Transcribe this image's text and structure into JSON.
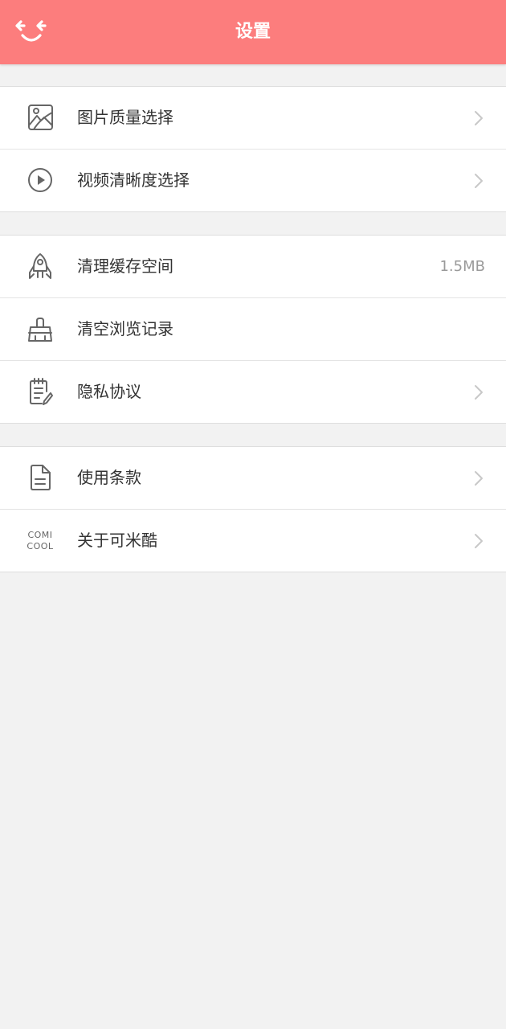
{
  "header": {
    "title": "设置",
    "back_icon": "smiley-back-arrows-icon",
    "background_color": "#fc7d7d"
  },
  "groups": [
    {
      "items": [
        {
          "label": "图片质量选择",
          "icon": "image-icon",
          "has_chevron": true
        },
        {
          "label": "视频清晰度选择",
          "icon": "play-circle-icon",
          "has_chevron": true
        }
      ]
    },
    {
      "items": [
        {
          "label": "清理缓存空间",
          "icon": "rocket-icon",
          "value": "1.5MB"
        },
        {
          "label": "清空浏览记录",
          "icon": "broom-icon"
        },
        {
          "label": "隐私协议",
          "icon": "notepad-icon",
          "has_chevron": true
        }
      ]
    },
    {
      "items": [
        {
          "label": "使用条款",
          "icon": "document-icon",
          "has_chevron": true
        },
        {
          "label": "关于可米酷",
          "icon": "comicool-logo-icon",
          "logo_text": [
            "COMI",
            "COOL"
          ],
          "has_chevron": true
        }
      ]
    }
  ],
  "colors": {
    "accent": "#fc7d7d",
    "page_background": "#f2f2f2",
    "icon_gray": "#666666",
    "chevron_gray": "#c8c8c8",
    "value_gray": "#9a9a9a"
  }
}
